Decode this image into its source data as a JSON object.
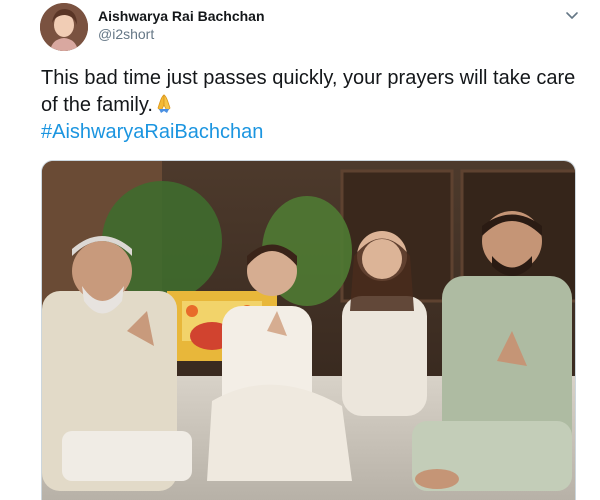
{
  "tweet": {
    "author_name": "Aishwarya Rai Bachchan",
    "author_handle": "@i2short",
    "text": "This bad time just passes quickly, your prayers will take care of the family.",
    "emoji": "folded-hands",
    "hashtag": "#AishwaryaRaiBachchan"
  },
  "icons": {
    "menu": "chevron-down-icon",
    "avatar": "profile-photo"
  },
  "colors": {
    "name": "#14171a",
    "handle": "#657786",
    "hashtag": "#1b95e0",
    "border": "#ccd6dd"
  }
}
